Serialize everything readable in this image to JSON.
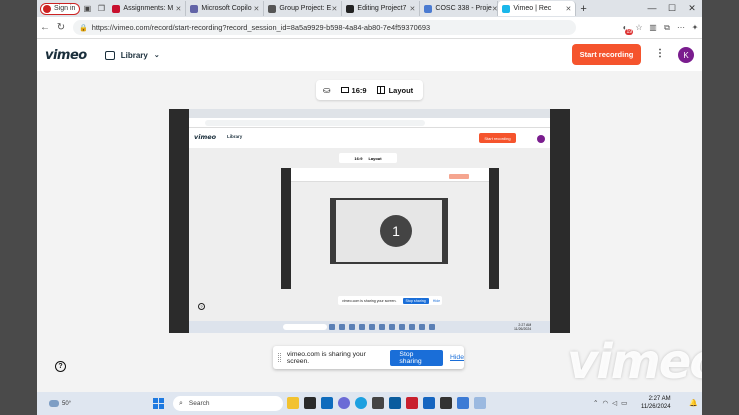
{
  "browser": {
    "signin_label": "Sign in",
    "tabs": [
      {
        "label": "Assignments: M",
        "color": "#c8102e"
      },
      {
        "label": "Microsoft Copilo",
        "color": "#6264a7"
      },
      {
        "label": "Group Project: E",
        "color": "#555555"
      },
      {
        "label": "Editing Project7",
        "color": "#222222"
      },
      {
        "label": "COSC 338 - Proje",
        "color": "#4b7bd1"
      },
      {
        "label": "Vimeo | Rec",
        "color": "#1ab7ea",
        "active": true
      }
    ],
    "new_tab": "+",
    "url": "https://vimeo.com/record/start-recording?record_session_id=8a5a9929-b598-4a84-ab80-7e4f59370693",
    "extension_badge": "19"
  },
  "vimeo": {
    "logo": "vimeo",
    "library_label": "Library",
    "start_recording": "Start recording",
    "avatar_initial": "K",
    "toolbar": {
      "aspect": "16:9",
      "layout": "Layout"
    },
    "countdown": "1",
    "share_message": "vimeo.com is sharing your screen.",
    "stop_sharing": "Stop sharing",
    "hide": "Hide",
    "watermark": "vimeo"
  },
  "taskbar": {
    "temperature": "50°",
    "search_placeholder": "Search",
    "time": "2:27 AM",
    "date": "11/26/2024"
  }
}
